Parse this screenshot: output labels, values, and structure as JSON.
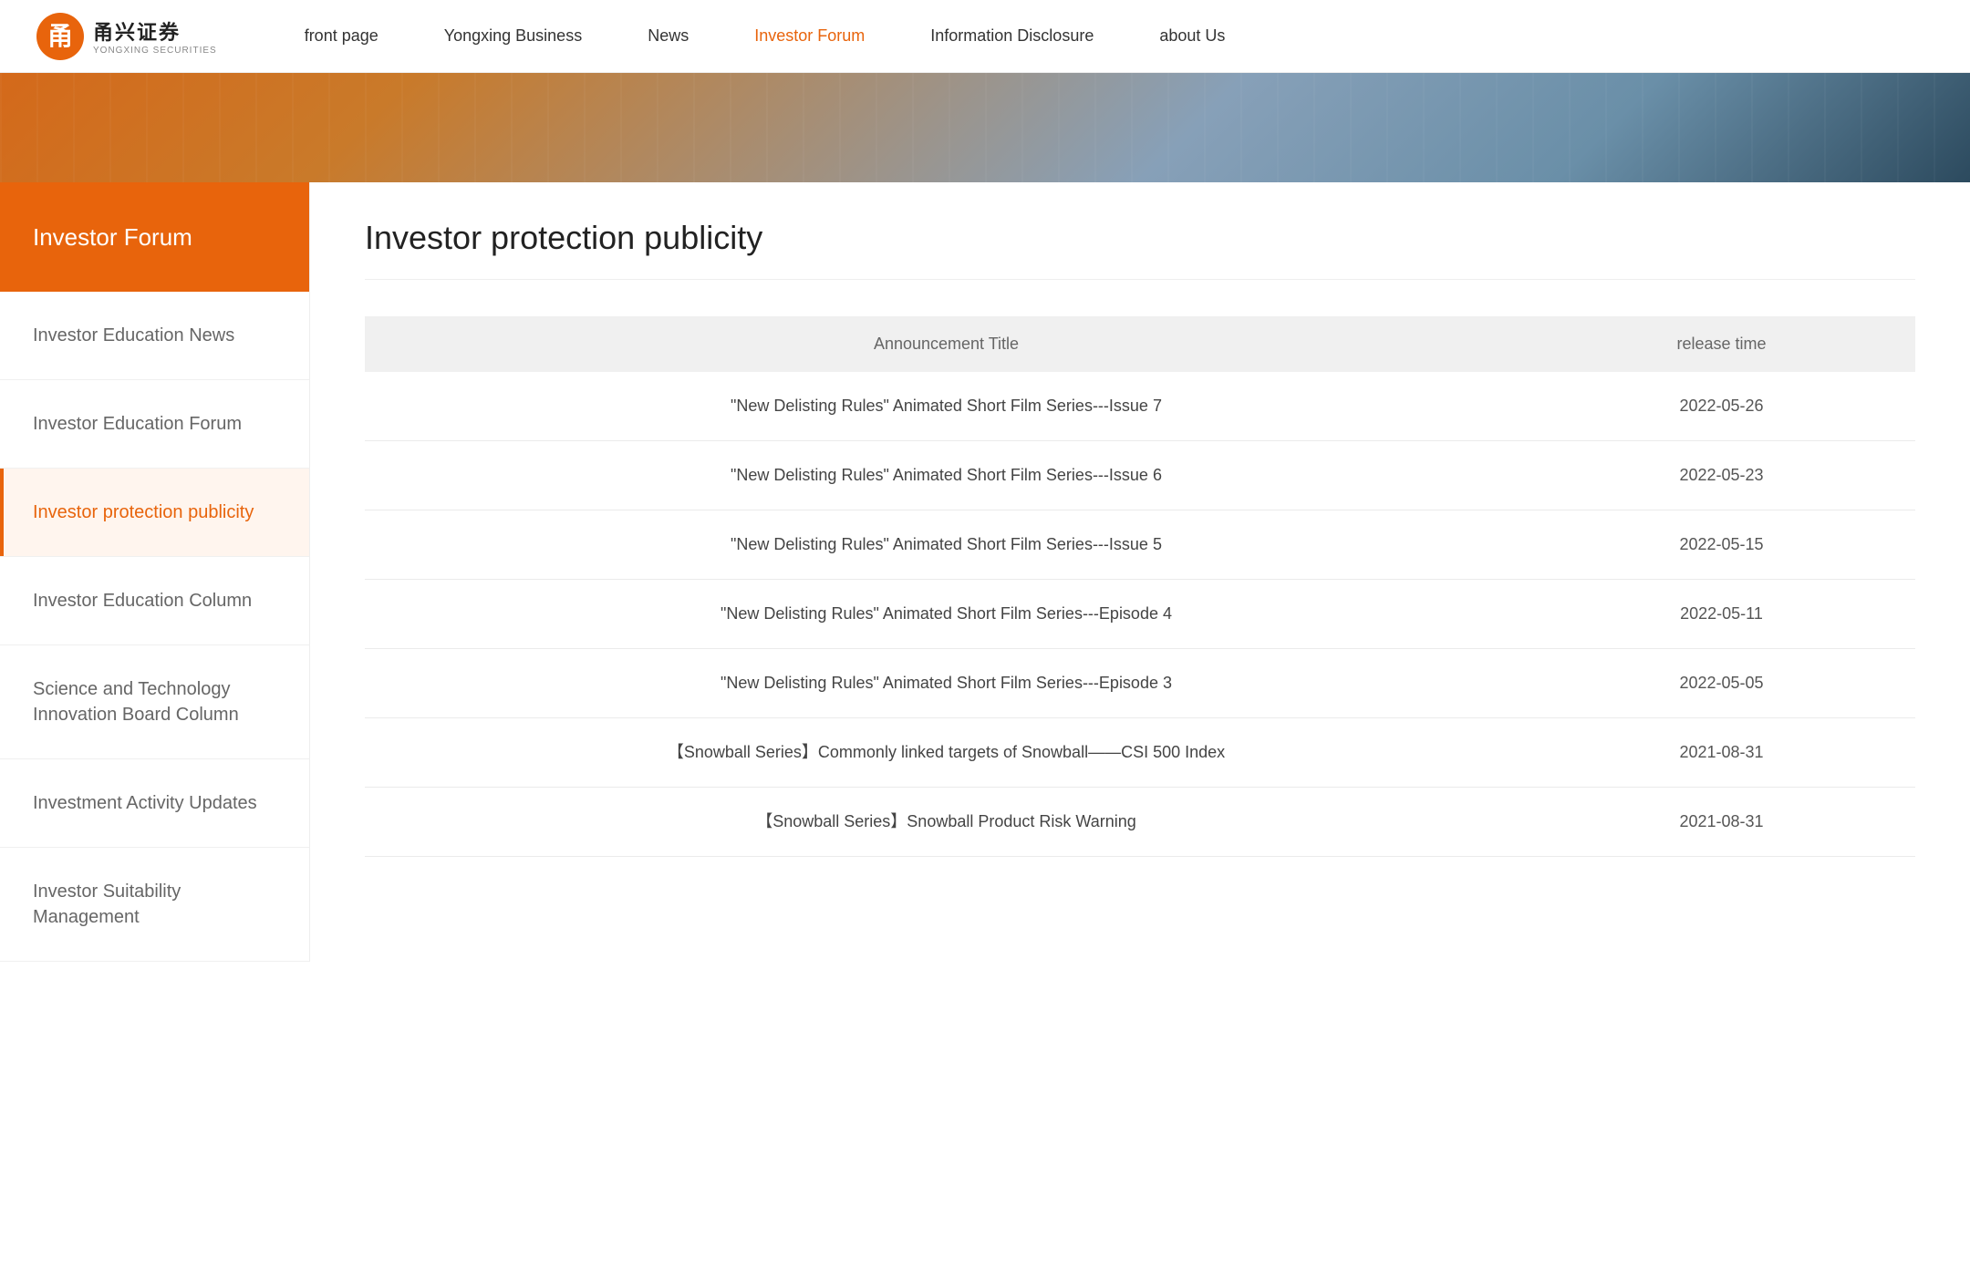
{
  "header": {
    "logo": {
      "cn_text": "甬兴证券",
      "en_text": "YONGXING SECURITIES"
    },
    "nav_items": [
      {
        "id": "front-page",
        "label": "front page",
        "active": false
      },
      {
        "id": "yongxing-business",
        "label": "Yongxing Business",
        "active": false
      },
      {
        "id": "news",
        "label": "News",
        "active": false
      },
      {
        "id": "investor-forum",
        "label": "Investor Forum",
        "active": true
      },
      {
        "id": "information-disclosure",
        "label": "Information Disclosure",
        "active": false
      },
      {
        "id": "about-us",
        "label": "about Us",
        "active": false
      }
    ]
  },
  "sidebar": {
    "header_label": "Investor Forum",
    "menu_items": [
      {
        "id": "education-news",
        "label": "Investor Education News",
        "active": false
      },
      {
        "id": "education-forum",
        "label": "Investor Education Forum",
        "active": false
      },
      {
        "id": "protection-publicity",
        "label": "Investor protection publicity",
        "active": true
      },
      {
        "id": "education-column",
        "label": "Investor Education Column",
        "active": false
      },
      {
        "id": "sci-tech-board",
        "label": "Science and Technology Innovation Board Column",
        "active": false
      },
      {
        "id": "investment-activity",
        "label": "Investment Activity Updates",
        "active": false
      },
      {
        "id": "investor-suitability",
        "label": "Investor Suitability Management",
        "active": false
      }
    ]
  },
  "content": {
    "title": "Investor protection publicity",
    "table": {
      "col_announcement": "Announcement Title",
      "col_release": "release time",
      "rows": [
        {
          "title": "\"New Delisting Rules\" Animated Short Film Series---Issue 7",
          "date": "2022-05-26"
        },
        {
          "title": "\"New Delisting Rules\" Animated Short Film Series---Issue 6",
          "date": "2022-05-23"
        },
        {
          "title": "\"New Delisting Rules\" Animated Short Film Series---Issue 5",
          "date": "2022-05-15"
        },
        {
          "title": "\"New Delisting Rules\" Animated Short Film Series---Episode 4",
          "date": "2022-05-11"
        },
        {
          "title": "\"New Delisting Rules\" Animated Short Film Series---Episode 3",
          "date": "2022-05-05"
        },
        {
          "title": "【Snowball Series】Commonly linked targets of Snowball——CSI 500 Index",
          "date": "2021-08-31"
        },
        {
          "title": "【Snowball Series】Snowball Product Risk Warning",
          "date": "2021-08-31"
        }
      ]
    }
  }
}
